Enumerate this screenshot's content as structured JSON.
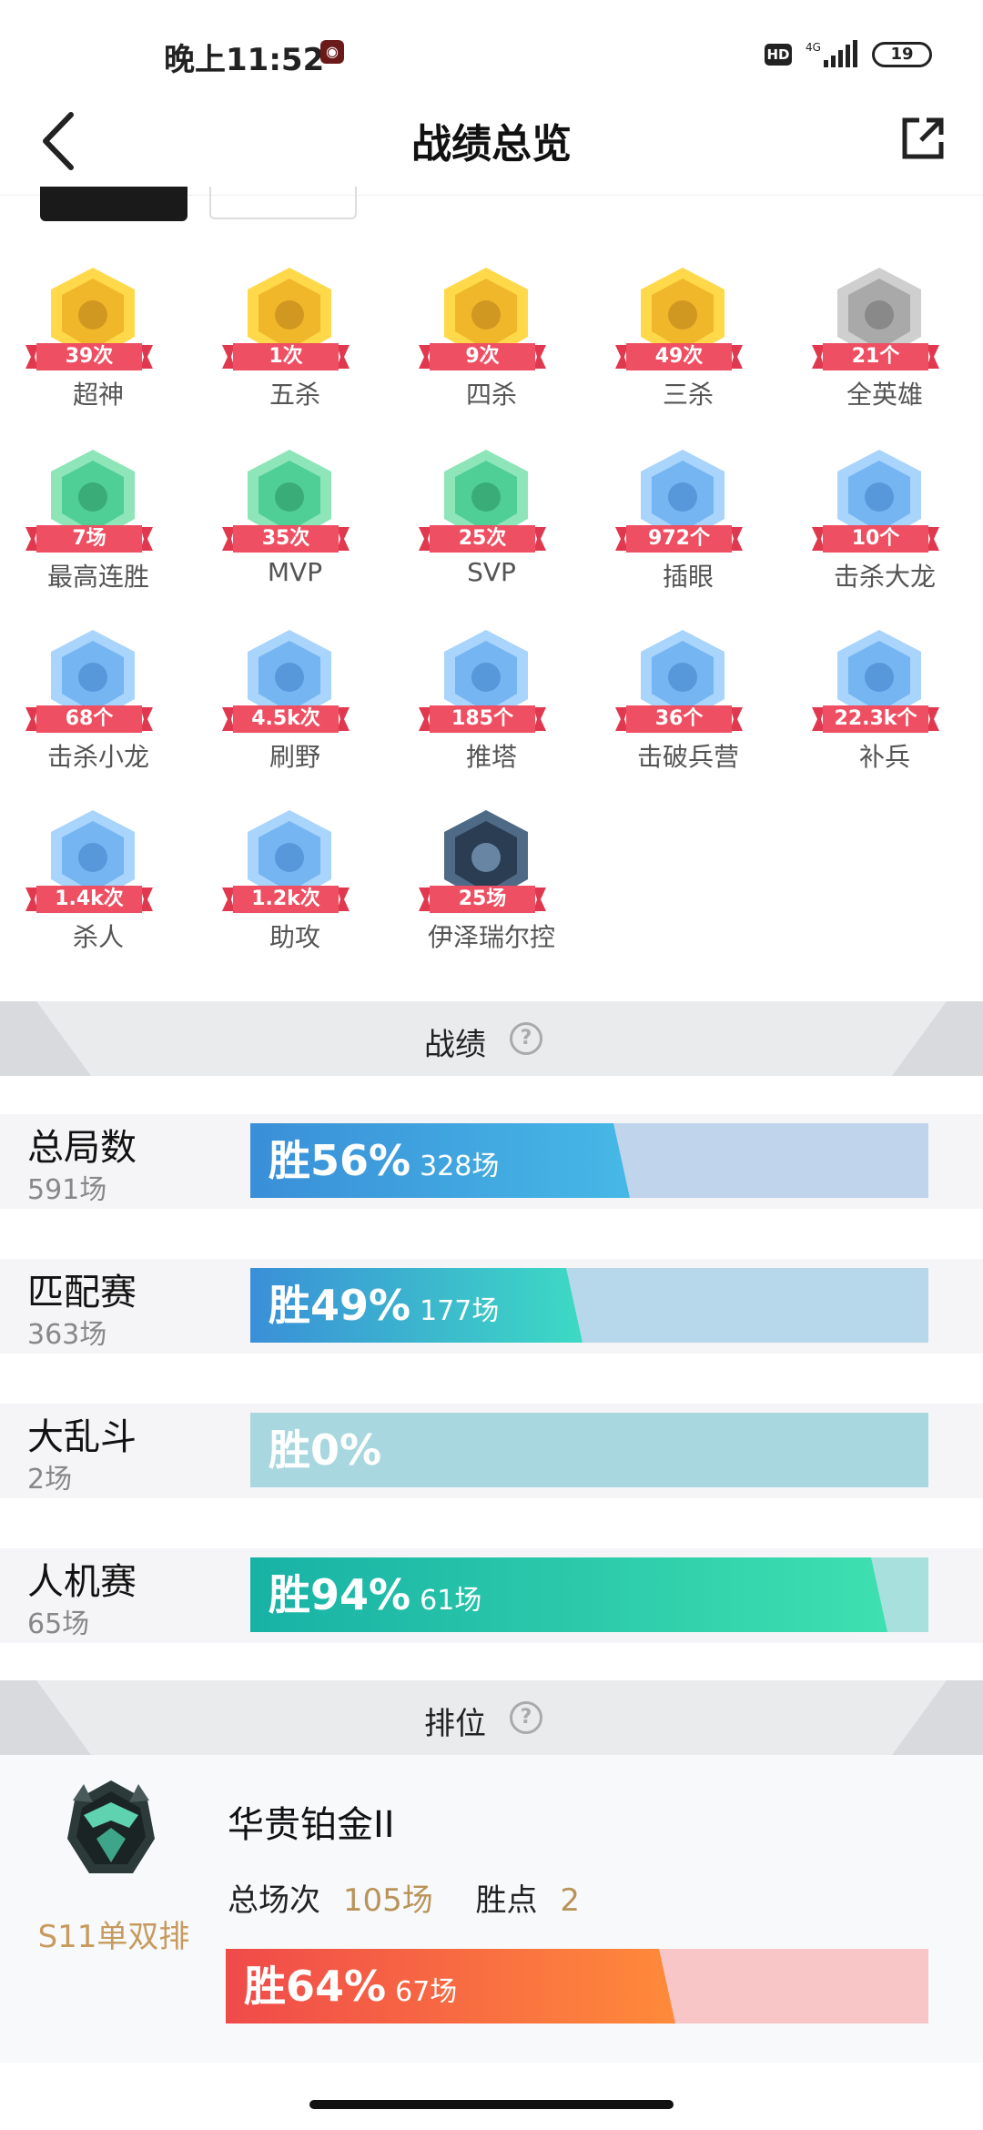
{
  "status_bar": {
    "time": "晚上11:52",
    "hd": "HD",
    "network": "4G",
    "battery": "19"
  },
  "header": {
    "title": "战绩总览"
  },
  "achievements": [
    {
      "label": "超神",
      "count": "39次",
      "icon": "god-badge-icon",
      "color": "gold"
    },
    {
      "label": "五杀",
      "count": "1次",
      "icon": "penta-kill-icon",
      "color": "gold"
    },
    {
      "label": "四杀",
      "count": "9次",
      "icon": "quadra-kill-icon",
      "color": "gold"
    },
    {
      "label": "三杀",
      "count": "49次",
      "icon": "triple-kill-icon",
      "color": "gold"
    },
    {
      "label": "全英雄",
      "count": "21个",
      "icon": "all-heroes-icon",
      "color": "gray"
    },
    {
      "label": "最高连胜",
      "count": "7场",
      "icon": "trophy-icon",
      "color": "green"
    },
    {
      "label": "MVP",
      "count": "35次",
      "icon": "mvp-icon",
      "color": "green"
    },
    {
      "label": "SVP",
      "count": "25次",
      "icon": "svp-icon",
      "color": "green"
    },
    {
      "label": "插眼",
      "count": "972个",
      "icon": "ward-icon",
      "color": "blue"
    },
    {
      "label": "击杀大龙",
      "count": "10个",
      "icon": "baron-icon",
      "color": "blue"
    },
    {
      "label": "击杀小龙",
      "count": "68个",
      "icon": "dragon-icon",
      "color": "blue"
    },
    {
      "label": "刷野",
      "count": "4.5k次",
      "icon": "jungle-icon",
      "color": "blue"
    },
    {
      "label": "推塔",
      "count": "185个",
      "icon": "tower-icon",
      "color": "blue"
    },
    {
      "label": "击破兵营",
      "count": "36个",
      "icon": "inhibitor-icon",
      "color": "blue"
    },
    {
      "label": "补兵",
      "count": "22.3k个",
      "icon": "minion-icon",
      "color": "blue"
    },
    {
      "label": "杀人",
      "count": "1.4k次",
      "icon": "kill-icon",
      "color": "blue"
    },
    {
      "label": "助攻",
      "count": "1.2k次",
      "icon": "assist-icon",
      "color": "blue"
    },
    {
      "label": "伊泽瑞尔控",
      "count": "25场",
      "icon": "ezreal-portrait-icon",
      "color": "dark"
    }
  ],
  "stats_section": {
    "title": "战绩",
    "help": "?"
  },
  "stats": [
    {
      "name": "总局数",
      "total": "591场",
      "win_label": "胜56%",
      "games": "328场",
      "win_rate": 0.56,
      "fill": "#3a8fd8",
      "fill2": "#46b8e6",
      "track": "#c0d4ec"
    },
    {
      "name": "匹配赛",
      "total": "363场",
      "win_label": "胜49%",
      "games": "177场",
      "win_rate": 0.49,
      "fill": "#3a8fd8",
      "fill2": "#3ddac4",
      "track": "#b7d7ea"
    },
    {
      "name": "大乱斗",
      "total": "2场",
      "win_label": "胜0%",
      "games": "",
      "win_rate": 0.0,
      "fill": "#3cb4c0",
      "fill2": "#3cb4c0",
      "track": "#a9d7df"
    },
    {
      "name": "人机赛",
      "total": "65场",
      "win_label": "胜94%",
      "games": "61场",
      "win_rate": 0.94,
      "fill": "#18b2a5",
      "fill2": "#3ee0b0",
      "track": "#a8e0de"
    }
  ],
  "rank_section": {
    "title": "排位",
    "help": "?"
  },
  "rank": {
    "tier": "华贵铂金II",
    "season": "S11单双排",
    "total_label": "总场次",
    "total_value": "105场",
    "points_label": "胜点",
    "points_value": "2",
    "win_label": "胜64%",
    "games": "67场",
    "win_rate": 0.64
  }
}
